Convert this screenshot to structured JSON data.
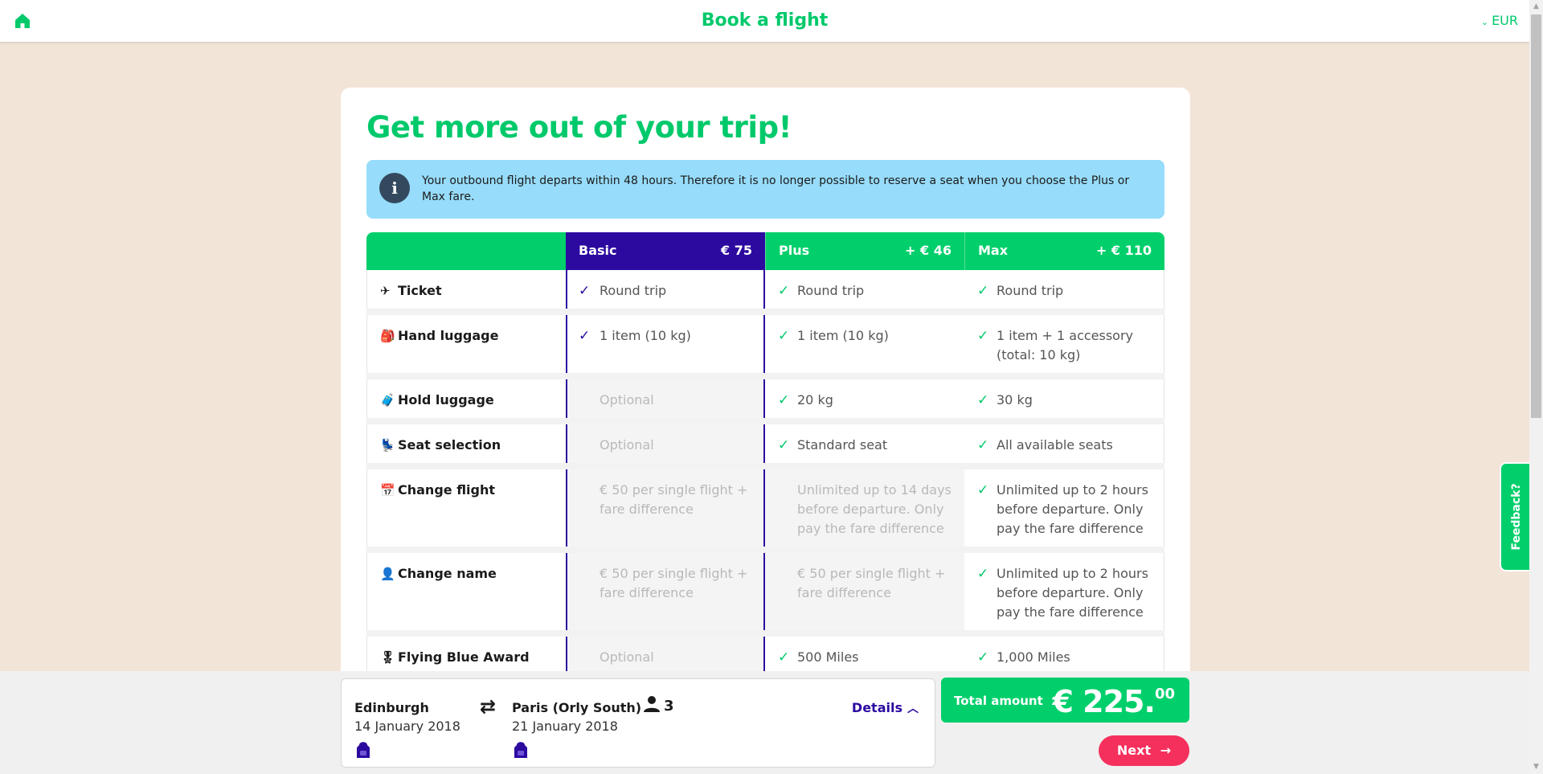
{
  "header": {
    "title": "Book a flight",
    "currency": "EUR",
    "home_icon": "home-icon"
  },
  "main": {
    "heading": "Get more out of your trip!",
    "notice": "Your outbound flight departs within 48 hours. Therefore it is no longer possible to reserve a seat when you choose the Plus or Max fare.",
    "notice_icon": "i"
  },
  "fares": {
    "columns": [
      {
        "name": "Basic",
        "price": "€ 75"
      },
      {
        "name": "Plus",
        "price": "+ € 46"
      },
      {
        "name": "Max",
        "price": "+ € 110"
      }
    ],
    "rows": [
      {
        "label": "Ticket",
        "icon": "✈",
        "basic": "Round trip",
        "plus": "Round trip",
        "max": "Round trip"
      },
      {
        "label": "Hand luggage",
        "icon": "🎒",
        "basic": "1 item (10 kg)",
        "plus": "1 item (10 kg)",
        "max": "1 item + 1 accessory (total: 10 kg)"
      },
      {
        "label": "Hold luggage",
        "icon": "🧳",
        "basic": "Optional",
        "plus": "20 kg",
        "max": "30 kg"
      },
      {
        "label": "Seat selection",
        "icon": "💺",
        "basic": "Optional",
        "plus": "Standard seat",
        "max": "All available seats"
      },
      {
        "label": "Change flight",
        "icon": "📅",
        "basic": "€ 50 per single flight + fare difference",
        "plus": "Unlimited up to 14 days before departure. Only pay the fare difference",
        "max": "Unlimited up to 2 hours before departure. Only pay the fare difference"
      },
      {
        "label": "Change name",
        "icon": "👤",
        "basic": "€ 50 per single flight + fare difference",
        "plus": "€ 50 per single flight + fare difference",
        "max": "Unlimited up to 2 hours before departure. Only pay the fare difference"
      },
      {
        "label": "Flying Blue Award Miles",
        "icon": "🎖",
        "basic": "Optional",
        "plus": "500 Miles",
        "max": "1,000 Miles"
      }
    ]
  },
  "trip": {
    "origin": "Edinburgh",
    "origin_date": "14 January 2018",
    "destination": "Paris (Orly South)",
    "destination_date": "21 January 2018",
    "swap_icon": "⇄",
    "passengers": "3",
    "details_label": "Details"
  },
  "total": {
    "label": "Total amount",
    "amount": "€ 225.",
    "cents": "00"
  },
  "next_label": "Next",
  "feedback_label": "Feedback?",
  "colors": {
    "brand_green": "#00c96b",
    "basic_purple": "#2c0aa0",
    "notice_blue": "#97dcfa",
    "next_pink": "#f5305d",
    "page_bg": "#f3e4d8"
  }
}
